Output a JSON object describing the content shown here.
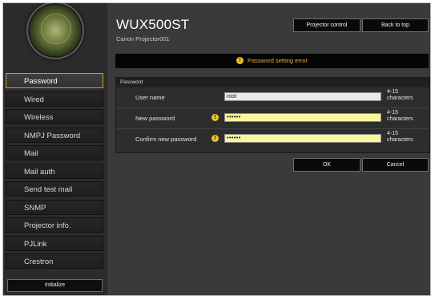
{
  "header": {
    "title": "WUX500ST",
    "subtitle": "Canon Projector001",
    "projector_control_label": "Projector control",
    "back_to_top_label": "Back to top"
  },
  "error_message": "Password setting error",
  "sidebar": {
    "items": [
      {
        "label": "Password",
        "active": true
      },
      {
        "label": "Wired"
      },
      {
        "label": "Wireless"
      },
      {
        "label": "NMPJ Password"
      },
      {
        "label": "Mail"
      },
      {
        "label": "Mail auth"
      },
      {
        "label": "Send test mail"
      },
      {
        "label": "SNMP"
      },
      {
        "label": "Projector info."
      },
      {
        "label": "PJLink"
      },
      {
        "label": "Crestron"
      }
    ],
    "initialize_label": "Initialize"
  },
  "form": {
    "section_title": "Password",
    "fields": [
      {
        "label": "User name",
        "value": "root",
        "hint_line1": "4-15",
        "hint_line2": "characters"
      },
      {
        "label": "New password",
        "value": "••••••",
        "hint_line1": "4-15",
        "hint_line2": "characters",
        "error": true
      },
      {
        "label": "Confirm new password",
        "value": "••••••",
        "hint_line1": "4-15",
        "hint_line2": "characters",
        "error": true
      }
    ],
    "ok_label": "OK",
    "cancel_label": "Cancel"
  },
  "colors": {
    "accent": "#d59a28",
    "error_text": "#e7b23a",
    "error_field": "#f9f69e",
    "warning_icon": "#e8c22c"
  },
  "icons": {
    "warning": "warning-icon",
    "logo": "lens-logo-icon"
  }
}
